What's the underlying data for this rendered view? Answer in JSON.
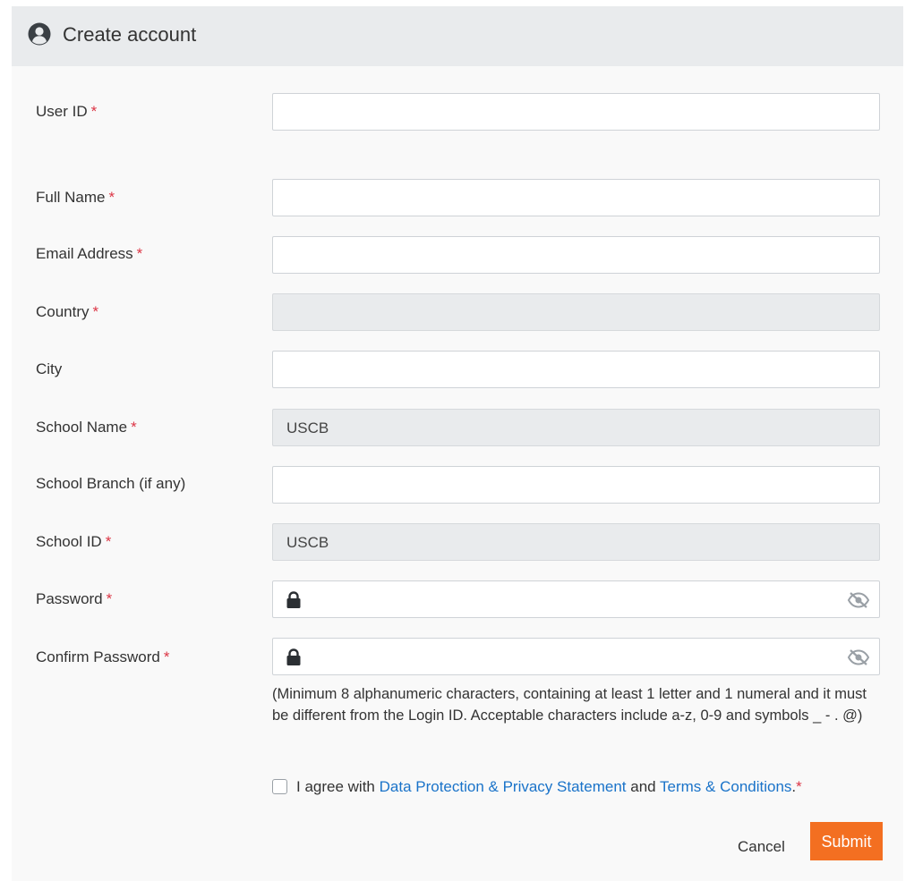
{
  "header": {
    "title": "Create account",
    "icon": "user-circle-icon"
  },
  "form": {
    "user_id": {
      "label": "User ID",
      "required": "*",
      "value": ""
    },
    "full_name": {
      "label": "Full Name",
      "required": "*",
      "value": ""
    },
    "email": {
      "label": "Email Address",
      "required": "*",
      "value": ""
    },
    "country": {
      "label": "Country",
      "required": "*",
      "value": ""
    },
    "city": {
      "label": "City",
      "value": ""
    },
    "school_name": {
      "label": "School Name",
      "required": "*",
      "value": "USCB"
    },
    "school_branch": {
      "label": "School Branch (if any)",
      "value": ""
    },
    "school_id": {
      "label": "School ID",
      "required": "*",
      "value": "USCB"
    },
    "password": {
      "label": "Password",
      "required": "*",
      "icon_left": "lock-icon",
      "icon_right": "eye-slash-icon"
    },
    "confirm_password": {
      "label": "Confirm Password",
      "required": "*",
      "icon_left": "lock-icon",
      "icon_right": "eye-slash-icon"
    },
    "hint": "(Minimum 8 alphanumeric characters, containing at least 1 letter and 1 numeral and it must be different from the Login ID. Acceptable characters include a-z, 0-9 and symbols _ - . @)",
    "agree": {
      "prefix": "I agree with ",
      "link1": "Data Protection & Privacy Statement",
      "middle": " and ",
      "link2": "Terms & Conditions",
      "suffix": ".",
      "required": "*",
      "checked": false
    }
  },
  "actions": {
    "cancel": "Cancel",
    "submit": "Submit"
  },
  "colors": {
    "accent": "#f36f21",
    "link": "#1a73c9",
    "required": "#dc3545",
    "header_bg": "#e9ebed"
  }
}
